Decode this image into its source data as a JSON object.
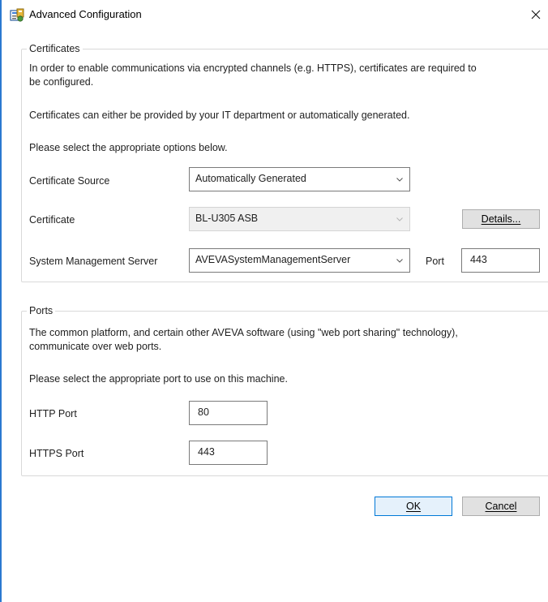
{
  "window": {
    "title": "Advanced Configuration"
  },
  "certificates": {
    "legend": "Certificates",
    "intro_line1": "In order to enable communications via encrypted channels (e.g. HTTPS), certificates are required to",
    "intro_line2": "be configured.",
    "info": "Certificates can either be provided by your IT department or automatically generated.",
    "prompt": "Please select the appropriate options below.",
    "source_label": "Certificate Source",
    "source_value": "Automatically Generated",
    "certificate_label": "Certificate",
    "certificate_value": "BL-U305 ASB",
    "details_button": "Details...",
    "sms_label": "System Management Server",
    "sms_value": "AVEVASystemManagementServer",
    "port_label": "Port",
    "port_value": "443"
  },
  "ports": {
    "legend": "Ports",
    "intro_line1": "The common platform, and certain other AVEVA software (using \"web port sharing\" technology),",
    "intro_line2": "communicate over web ports.",
    "prompt": "Please select the appropriate port to use on this machine.",
    "http_label": "HTTP Port",
    "http_value": "80",
    "https_label": "HTTPS Port",
    "https_value": "443"
  },
  "buttons": {
    "ok": "OK",
    "cancel": "Cancel"
  },
  "colors": {
    "accent": "#2b79d0",
    "default_button_border": "#0078d7"
  },
  "icons": {
    "app": "configuration-app-icon",
    "close": "close-icon",
    "dropdown": "chevron-down-icon"
  }
}
